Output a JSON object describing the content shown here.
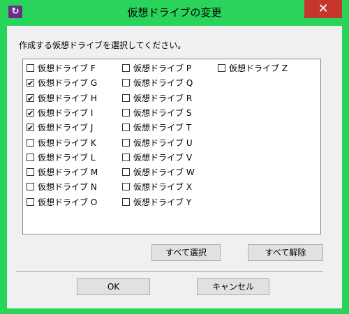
{
  "window": {
    "title": "仮想ドライブの変更"
  },
  "close_symbol": "✕",
  "icon_glyph": "↻",
  "instruction": "作成する仮想ドライブを選択してください。",
  "drives": [
    {
      "label": "仮想ドライブ F",
      "checked": false
    },
    {
      "label": "仮想ドライブ G",
      "checked": true
    },
    {
      "label": "仮想ドライブ H",
      "checked": true
    },
    {
      "label": "仮想ドライブ I",
      "checked": true
    },
    {
      "label": "仮想ドライブ J",
      "checked": true
    },
    {
      "label": "仮想ドライブ K",
      "checked": false
    },
    {
      "label": "仮想ドライブ L",
      "checked": false
    },
    {
      "label": "仮想ドライブ M",
      "checked": false
    },
    {
      "label": "仮想ドライブ N",
      "checked": false
    },
    {
      "label": "仮想ドライブ O",
      "checked": false
    },
    {
      "label": "仮想ドライブ P",
      "checked": false
    },
    {
      "label": "仮想ドライブ Q",
      "checked": false
    },
    {
      "label": "仮想ドライブ R",
      "checked": false
    },
    {
      "label": "仮想ドライブ S",
      "checked": false
    },
    {
      "label": "仮想ドライブ T",
      "checked": false
    },
    {
      "label": "仮想ドライブ U",
      "checked": false
    },
    {
      "label": "仮想ドライブ V",
      "checked": false
    },
    {
      "label": "仮想ドライブ W",
      "checked": false
    },
    {
      "label": "仮想ドライブ X",
      "checked": false
    },
    {
      "label": "仮想ドライブ Y",
      "checked": false
    },
    {
      "label": "仮想ドライブ Z",
      "checked": false
    }
  ],
  "buttons": {
    "select_all": "すべて選択",
    "deselect_all": "すべて解除",
    "ok": "OK",
    "cancel": "キャンセル"
  }
}
